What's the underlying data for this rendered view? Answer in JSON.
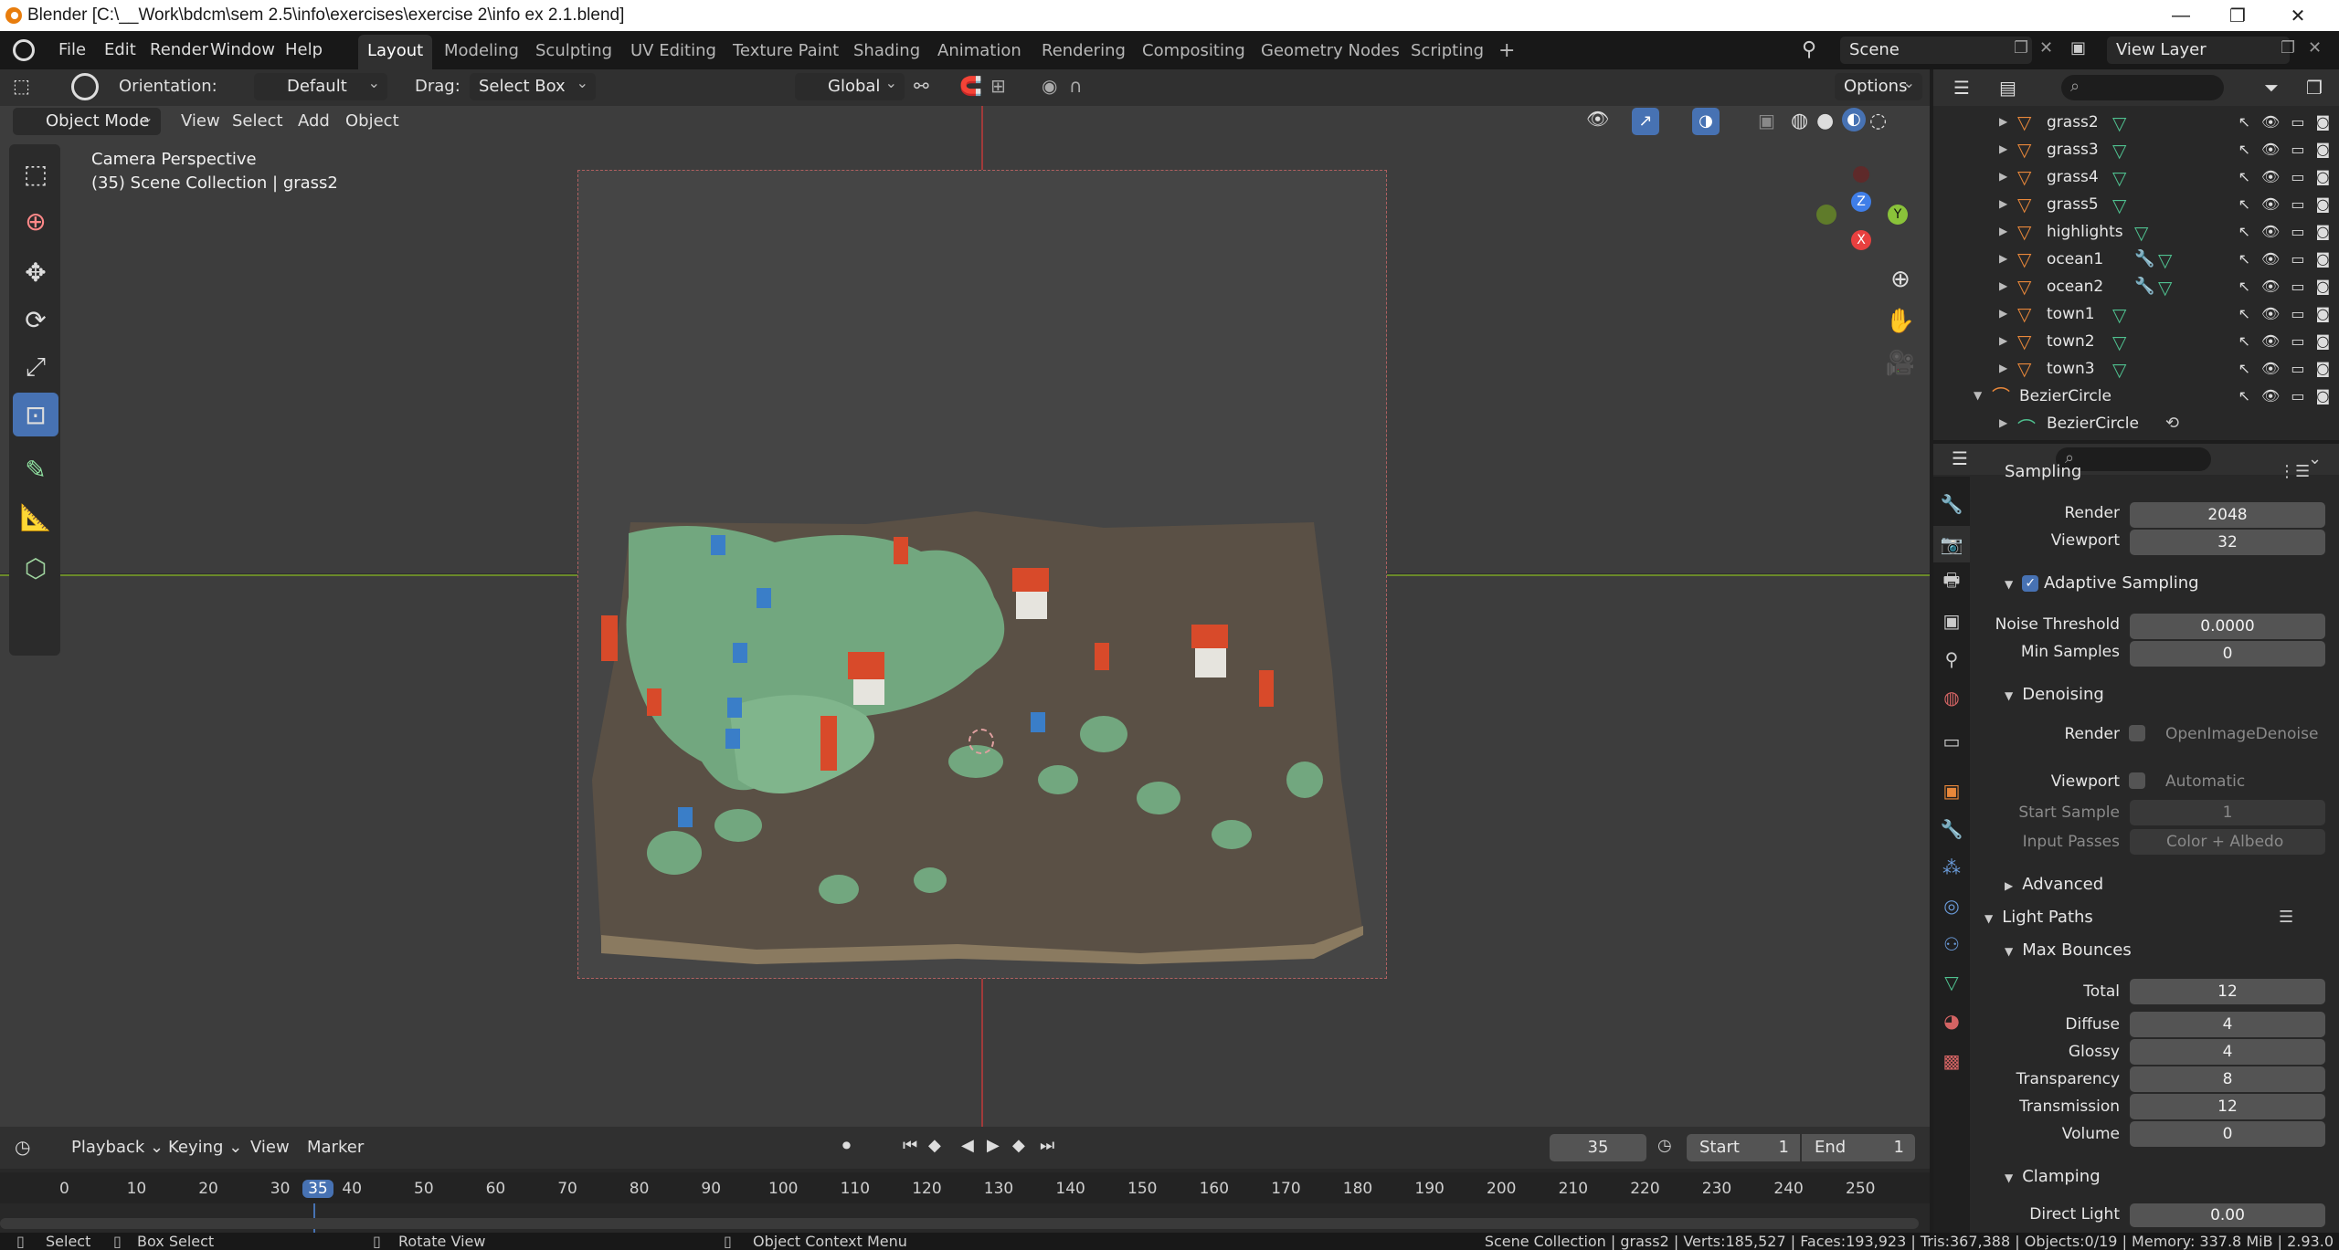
{
  "window": {
    "title": "Blender [C:\\__Work\\bdcm\\sem 2.5\\info\\exercises\\exercise 2\\info ex 2.1.blend]"
  },
  "menu": [
    "File",
    "Edit",
    "Render",
    "Window",
    "Help"
  ],
  "workspaces": [
    "Layout",
    "Modeling",
    "Sculpting",
    "UV Editing",
    "Texture Paint",
    "Shading",
    "Animation",
    "Rendering",
    "Compositing",
    "Geometry Nodes",
    "Scripting"
  ],
  "scene": {
    "name": "Scene",
    "view_layer": "View Layer"
  },
  "header": {
    "orientation_label": "Orientation:",
    "orientation_value": "Default",
    "drag_label": "Drag:",
    "drag_value": "Select Box",
    "transform_space": "Global",
    "options": "Options"
  },
  "viewport_menu": {
    "mode": "Object Mode",
    "items": [
      "View",
      "Select",
      "Add",
      "Object"
    ]
  },
  "viewport_overlay": {
    "line1": "Camera Perspective",
    "line2": "(35) Scene Collection | grass2"
  },
  "gizmo": {
    "x": "X",
    "y": "Y",
    "z": "Z"
  },
  "outliner": {
    "rows": [
      {
        "name": "grass2",
        "extra": ""
      },
      {
        "name": "grass3",
        "extra": ""
      },
      {
        "name": "grass4",
        "extra": ""
      },
      {
        "name": "grass5",
        "extra": ""
      },
      {
        "name": "highlights",
        "extra": ""
      },
      {
        "name": "ocean1",
        "extra": "modifier"
      },
      {
        "name": "ocean2",
        "extra": "modifier"
      },
      {
        "name": "town1",
        "extra": ""
      },
      {
        "name": "town2",
        "extra": ""
      },
      {
        "name": "town3",
        "extra": ""
      }
    ],
    "curve_parent": "BezierCircle",
    "curve_child": "BezierCircle"
  },
  "properties": {
    "sampling_header": "Sampling",
    "render_label": "Render",
    "render_value": "2048",
    "viewport_label": "Viewport",
    "viewport_value": "32",
    "adaptive_label": "Adaptive Sampling",
    "noise_label": "Noise Threshold",
    "noise_value": "0.0000",
    "min_samples_label": "Min Samples",
    "min_samples_value": "0",
    "denoising_header": "Denoising",
    "den_render_label": "Render",
    "den_render_value": "OpenImageDenoise",
    "den_viewport_label": "Viewport",
    "den_viewport_value": "Automatic",
    "start_sample_label": "Start Sample",
    "start_sample_value": "1",
    "input_passes_label": "Input Passes",
    "input_passes_value": "Color + Albedo",
    "advanced_header": "Advanced",
    "light_paths_header": "Light Paths",
    "max_bounces_header": "Max Bounces",
    "bounces": [
      {
        "label": "Total",
        "value": "12"
      },
      {
        "label": "Diffuse",
        "value": "4"
      },
      {
        "label": "Glossy",
        "value": "4"
      },
      {
        "label": "Transparency",
        "value": "8"
      },
      {
        "label": "Transmission",
        "value": "12"
      },
      {
        "label": "Volume",
        "value": "0"
      }
    ],
    "clamping_header": "Clamping",
    "direct_light_label": "Direct Light",
    "direct_light_value": "0.00"
  },
  "timeline": {
    "menus": [
      "Playback",
      "Keying",
      "View",
      "Marker"
    ],
    "current_frame": "35",
    "start_label": "Start",
    "start_value": "1",
    "end_label": "End",
    "end_value": "1",
    "ruler": [
      "0",
      "10",
      "20",
      "30",
      "35",
      "40",
      "50",
      "60",
      "70",
      "80",
      "90",
      "100",
      "110",
      "120",
      "130",
      "140",
      "150",
      "160",
      "170",
      "180",
      "190",
      "200",
      "210",
      "220",
      "230",
      "240",
      "250"
    ]
  },
  "status": {
    "select": "Select",
    "box_select": "Box Select",
    "rotate": "Rotate View",
    "context_menu": "Object Context Menu",
    "stats": "Scene Collection | grass2 | Verts:185,527 | Faces:193,923 | Tris:367,388 | Objects:0/19 | Memory: 337.8 MiB | 2.93.0"
  }
}
